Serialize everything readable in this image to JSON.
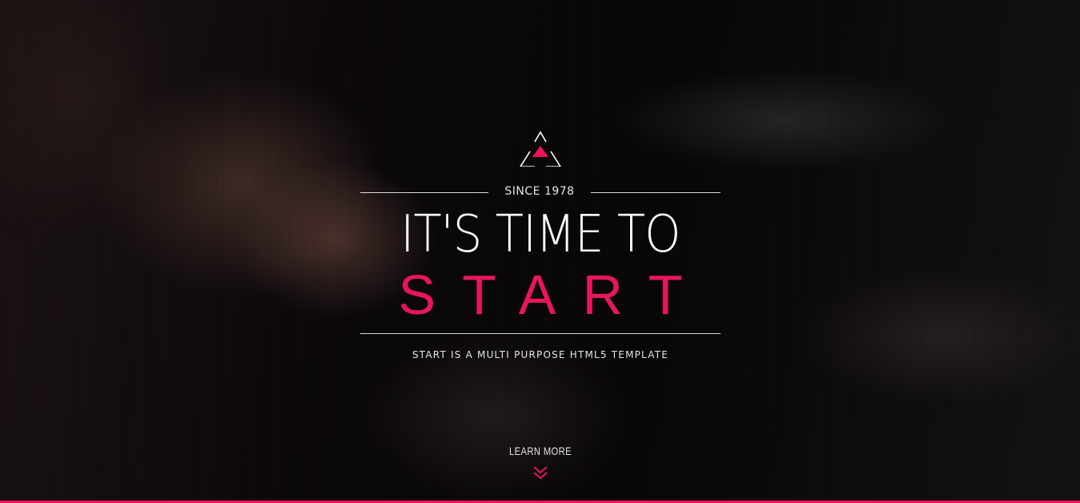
{
  "hero": {
    "since": "SINCE 1978",
    "headline": "IT'S TIME TO",
    "start_word": "START",
    "tagline": "START IS A MULTI PURPOSE HTML5 TEMPLATE",
    "learn_more": "LEARN MORE"
  },
  "icons": {
    "logo": "triangle-logo-icon",
    "scroll": "double-chevron-down-icon"
  },
  "colors": {
    "accent": "#e8155f",
    "text": "#ffffff",
    "background": "#0b0809"
  }
}
